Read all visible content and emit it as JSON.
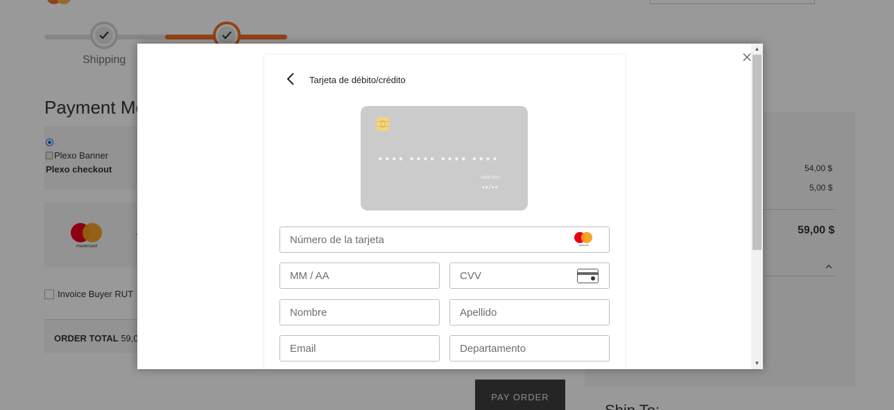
{
  "checkout": {
    "steps": [
      {
        "label": "Shipping",
        "state": "complete"
      },
      {
        "label": "",
        "state": "complete-active"
      }
    ],
    "payment_method": {
      "title": "Payment Me",
      "banner_alt": "Plexo Banner",
      "option_label": "Plexo checkout",
      "card_brand_label": "mastercard"
    },
    "invoice_checkbox_label": "Invoice Buyer RUT",
    "order_total_label": "ORDER TOTAL",
    "order_total_value": "59,0",
    "pay_order_label": "PAY ORDER"
  },
  "summary": {
    "line1_value": "54,00 $",
    "line2_value": "5,00 $",
    "total_value": "59,00 $",
    "ship_to_label": "Ship To:"
  },
  "modal": {
    "title": "Tarjeta de débito/crédito",
    "card": {
      "number_mask": "•••• •••• •••• ••••",
      "valid_thru_label": "valid thru",
      "expiry_mask": "••/••"
    },
    "fields": {
      "card_number": {
        "value": "",
        "placeholder": "Número de la tarjeta"
      },
      "expiry": {
        "value": "",
        "placeholder": "MM / AA"
      },
      "cvv": {
        "value": "",
        "placeholder": "CVV"
      },
      "first_name": {
        "value": "",
        "placeholder": "Nombre"
      },
      "last_name": {
        "value": "",
        "placeholder": "Apellido"
      },
      "email": {
        "value": "",
        "placeholder": "Email"
      },
      "department": {
        "value": "",
        "placeholder": "Departamento"
      }
    },
    "brand_icon_label": "mastercard"
  },
  "icons": {
    "close": "close-icon",
    "back": "chevron-left-icon",
    "step_check": "check-icon",
    "chip": "card-chip-icon",
    "brand": "mastercard-icon",
    "cvv": "cvv-card-icon",
    "caret": "chevron-up-icon"
  },
  "colors": {
    "accent": "#f46f25",
    "overlay": "rgba(0,0,0,0.40)",
    "card_face": "#cbcbcb",
    "mastercard_red": "#eb001b",
    "mastercard_yellow": "#f79e1b"
  }
}
